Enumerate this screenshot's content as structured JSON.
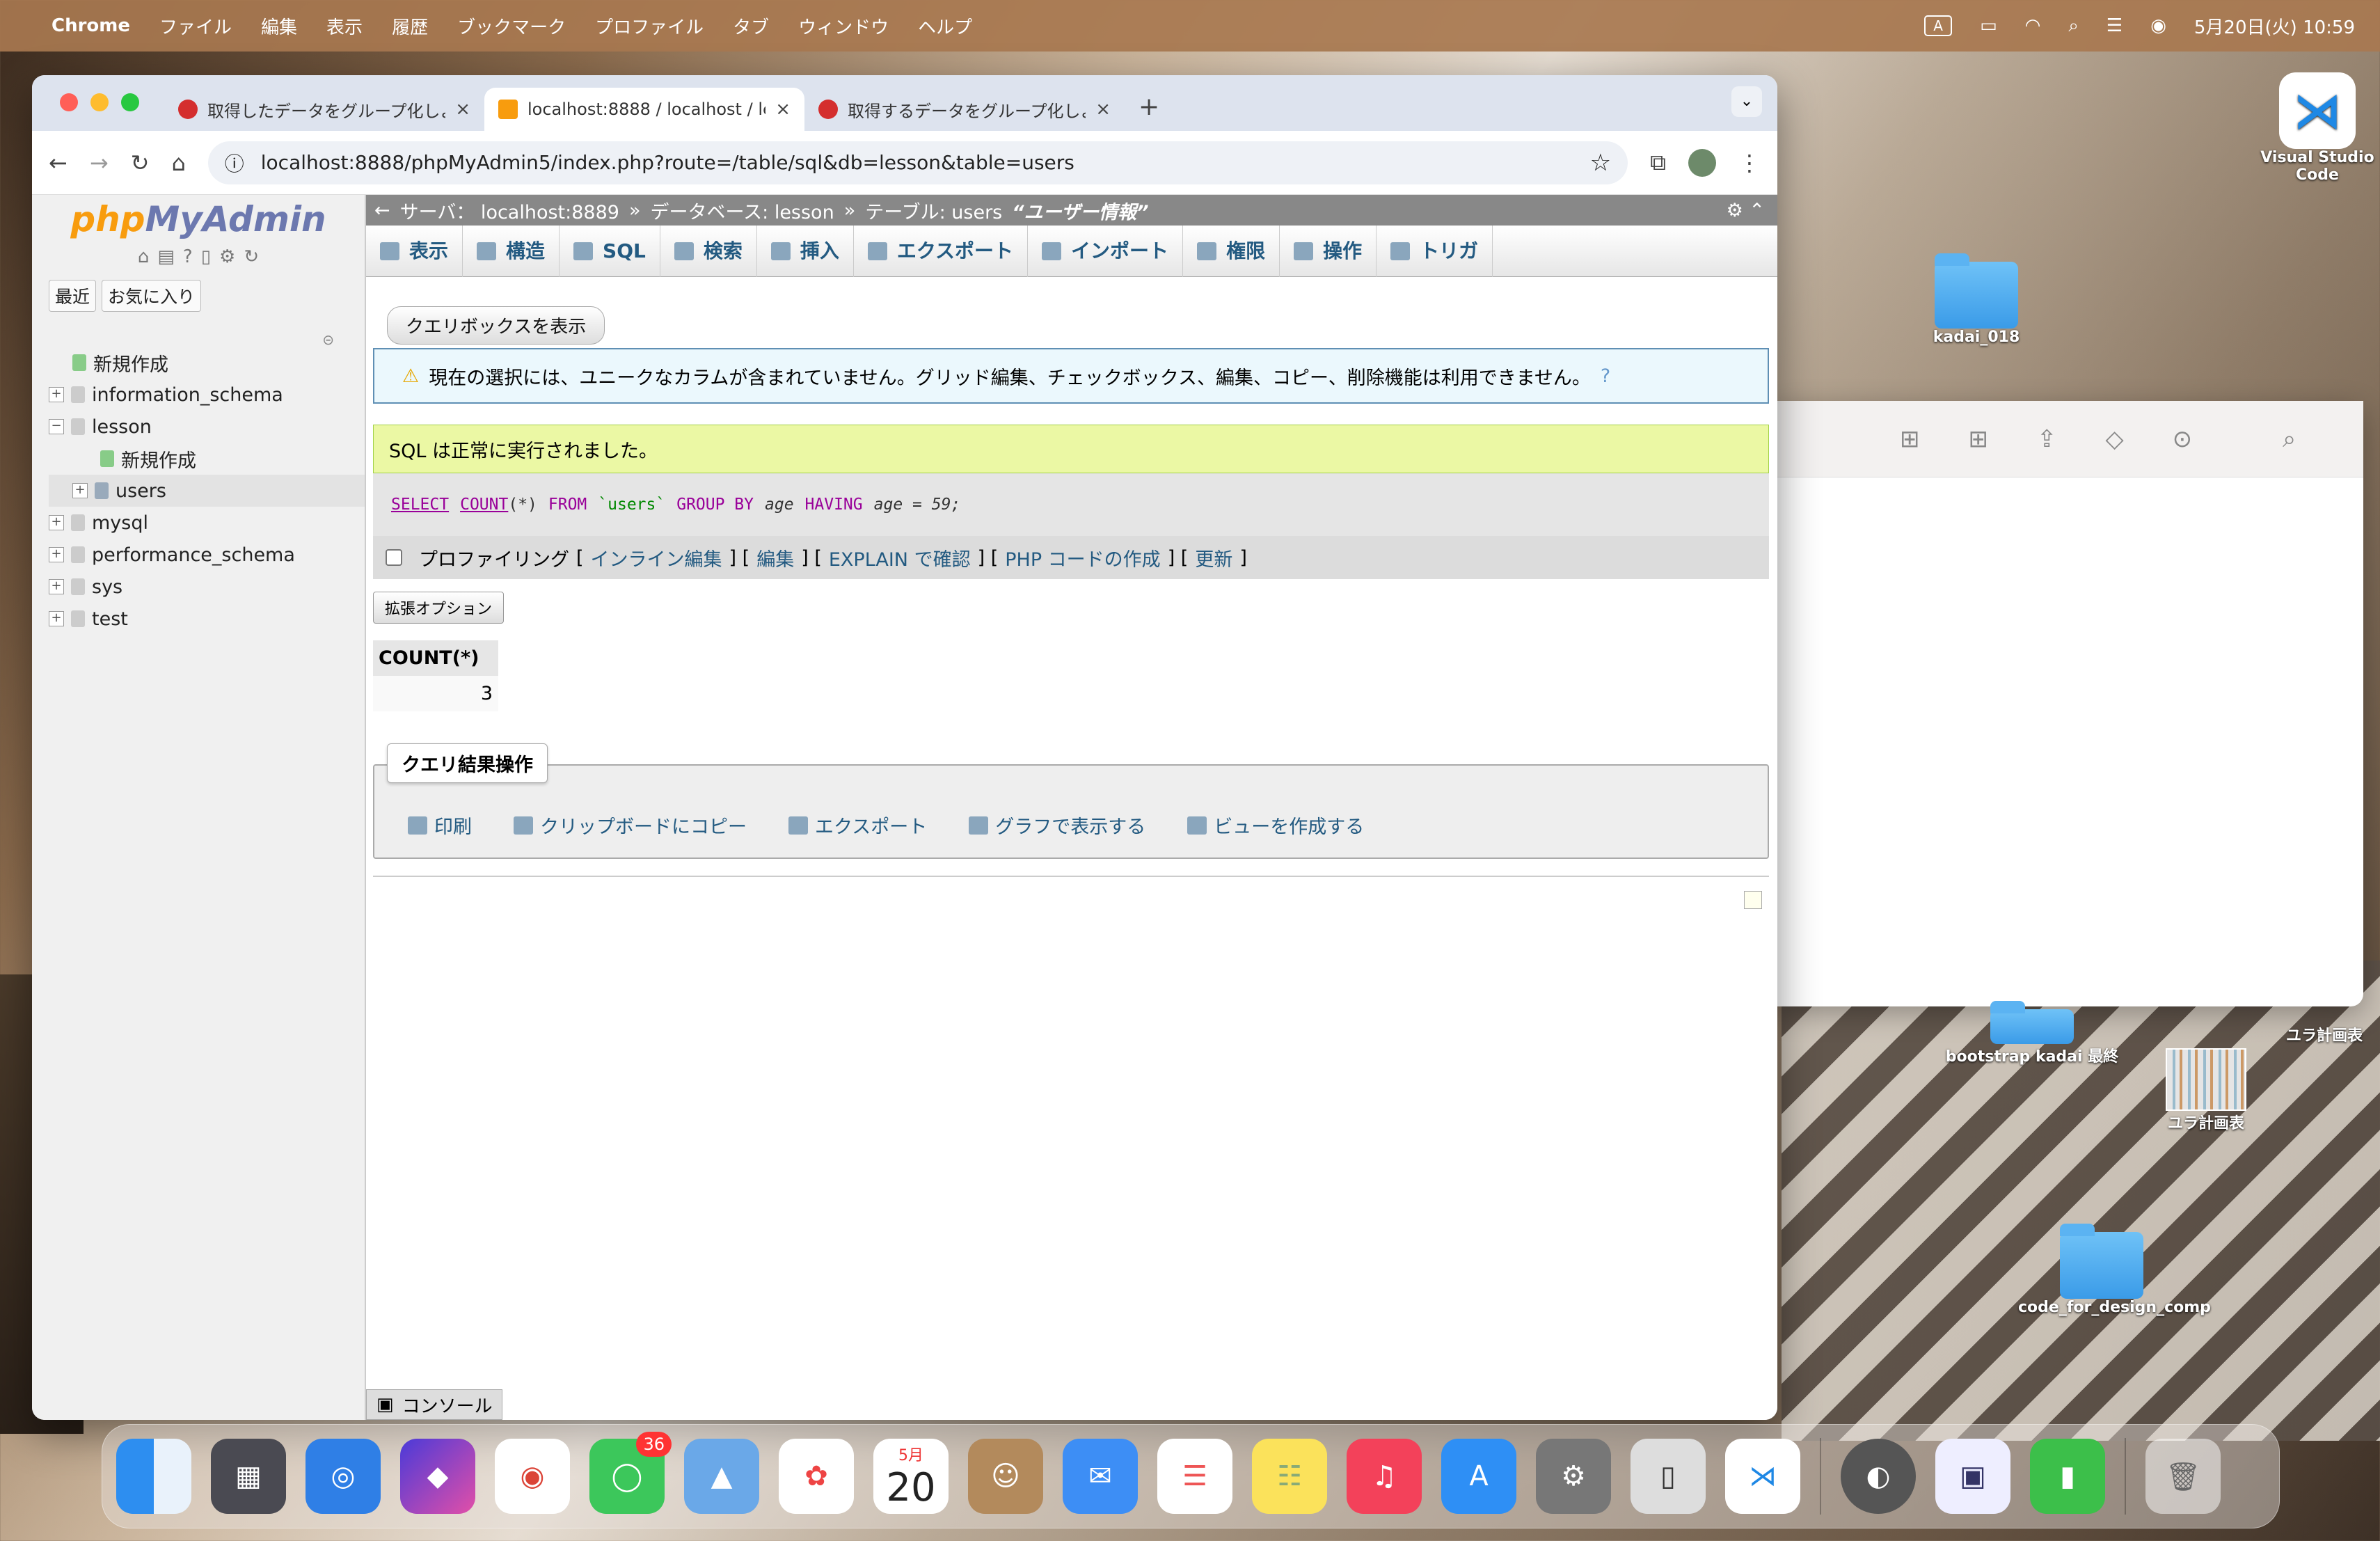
{
  "menubar": {
    "app": "Chrome",
    "items": [
      "ファイル",
      "編集",
      "表示",
      "履歴",
      "ブックマーク",
      "プロファイル",
      "タブ",
      "ウィンドウ",
      "ヘルプ"
    ],
    "input_mode": "A",
    "datetime": "5月20日(火) 10:59"
  },
  "desktop": {
    "vscode": "Visual Studio Code",
    "folder1": "kadai_018",
    "folder2": "bootstrap kadai 最終",
    "file1": "ユラ計画表",
    "file2": "ユラ計画表",
    "folder3": "code_for_design_comp"
  },
  "tabs": [
    {
      "title": "取得したデータをグループ化しよ"
    },
    {
      "title": "localhost:8888 / localhost / le"
    },
    {
      "title": "取得するデータをグループ化しよ"
    }
  ],
  "url": "localhost:8888/phpMyAdmin5/index.php?route=/table/sql&db=lesson&table=users",
  "nav": {
    "logo_php": "php",
    "logo_ma": "MyAdmin",
    "recent": "最近",
    "favorites": "お気に入り",
    "tree": [
      {
        "label": "新規作成",
        "level": 0
      },
      {
        "label": "information_schema",
        "level": 0
      },
      {
        "label": "lesson",
        "level": 0
      },
      {
        "label": "新規作成",
        "level": 1
      },
      {
        "label": "users",
        "level": 1
      },
      {
        "label": "mysql",
        "level": 0
      },
      {
        "label": "performance_schema",
        "level": 0
      },
      {
        "label": "sys",
        "level": 0
      },
      {
        "label": "test",
        "level": 0
      }
    ]
  },
  "breadcrumb": {
    "server": "サーバ： localhost:8889",
    "database": "データベース: lesson",
    "table": "テーブル: users",
    "comment": "“ユーザー情報”"
  },
  "menu": [
    "表示",
    "構造",
    "SQL",
    "検索",
    "挿入",
    "エクスポート",
    "インポート",
    "権限",
    "操作",
    "トリガ"
  ],
  "show_query_box": "クエリボックスを表示",
  "warning": "現在の選択には、ユニークなカラムが含まれていません。グリッド編集、チェックボックス、編集、コピー、削除機能は利用できません。",
  "success": "SQL は正常に実行されました。",
  "sql": {
    "select": "SELECT",
    "count": "COUNT",
    "star": "(*)",
    "from": "FROM",
    "table": "`users`",
    "group": "GROUP BY",
    "col": "age",
    "having": "HAVING",
    "cond": "age = 59;"
  },
  "profiling": {
    "label": "プロファイリング",
    "inline": "インライン編集",
    "edit": "編集",
    "explain": "EXPLAIN で確認",
    "php": "PHP コードの作成",
    "refresh": "更新"
  },
  "ext_options": "拡張オプション",
  "result": {
    "header": "COUNT(*)",
    "value": "3"
  },
  "query_ops": {
    "legend": "クエリ結果操作",
    "print": "印刷",
    "copy": "クリップボードにコピー",
    "export": "エクスポート",
    "chart": "グラフで表示する",
    "view": "ビューを作成する"
  },
  "console": "コンソール",
  "dock": {
    "messages_badge": "36",
    "calendar_month": "5月",
    "calendar_day": "20"
  }
}
